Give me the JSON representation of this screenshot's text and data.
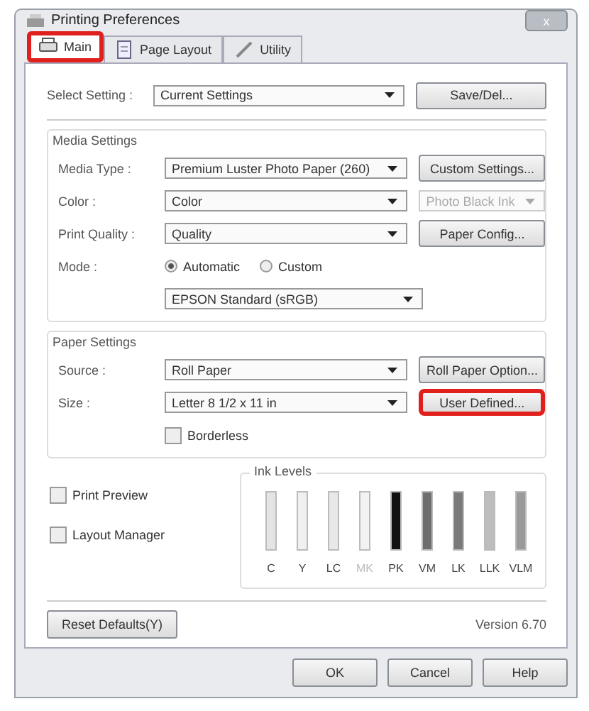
{
  "window": {
    "title": "Printing Preferences",
    "close": "x"
  },
  "tabs": [
    {
      "label": "Main",
      "selected": true,
      "highlighted": true
    },
    {
      "label": "Page Layout",
      "selected": false,
      "highlighted": false
    },
    {
      "label": "Utility",
      "selected": false,
      "highlighted": false
    }
  ],
  "select_setting": {
    "label": "Select Setting :",
    "value": "Current Settings",
    "button": {
      "label": "Save/Del...",
      "highlighted": false
    }
  },
  "media_settings": {
    "title": "Media Settings",
    "rows": [
      {
        "kind": "dropdown",
        "label": "Media Type :",
        "value": "Premium Luster Photo Paper (260)",
        "side": {
          "kind": "button",
          "label": "Custom Settings...",
          "highlighted": false
        }
      },
      {
        "kind": "dropdown",
        "label": "Color :",
        "value": "Color",
        "side": {
          "kind": "dropdown",
          "label": "Photo Black Ink",
          "disabled": true
        }
      },
      {
        "kind": "dropdown",
        "label": "Print Quality :",
        "value": "Quality",
        "side": {
          "kind": "button",
          "label": "Paper Config...",
          "highlighted": false
        }
      },
      {
        "kind": "radios",
        "label": "Mode :",
        "options": [
          {
            "label": "Automatic",
            "selected": true
          },
          {
            "label": "Custom",
            "selected": false
          }
        ]
      },
      {
        "kind": "dropdown",
        "value": "EPSON Standard (sRGB)"
      }
    ]
  },
  "paper_settings": {
    "title": "Paper Settings",
    "rows": [
      {
        "kind": "dropdown",
        "label": "Source :",
        "value": "Roll Paper",
        "side": {
          "kind": "button",
          "label": "Roll Paper Option...",
          "highlighted": false
        }
      },
      {
        "kind": "dropdown",
        "label": "Size :",
        "value": "Letter 8 1/2 x 11 in",
        "side": {
          "kind": "button",
          "label": "User Defined...",
          "highlighted": true
        }
      },
      {
        "kind": "checkbox",
        "label": "Borderless",
        "checked": false
      }
    ]
  },
  "options": [
    {
      "label": "Print Preview",
      "checked": false
    },
    {
      "label": "Layout Manager",
      "checked": false
    }
  ],
  "ink_levels": {
    "title": "Ink Levels",
    "inks": [
      {
        "name": "C",
        "color": "#e4e4e4",
        "disabled": false
      },
      {
        "name": "Y",
        "color": "#f0f0f0",
        "disabled": false
      },
      {
        "name": "LC",
        "color": "#e8e8e8",
        "disabled": false
      },
      {
        "name": "MK",
        "color": "#f2f2f2",
        "disabled": true
      },
      {
        "name": "PK",
        "color": "#111111",
        "disabled": false
      },
      {
        "name": "VM",
        "color": "#6e6e6e",
        "disabled": false
      },
      {
        "name": "LK",
        "color": "#7a7a7a",
        "disabled": false
      },
      {
        "name": "LLK",
        "color": "#bdbdbd",
        "disabled": false
      },
      {
        "name": "VLM",
        "color": "#9a9a9a",
        "disabled": false
      }
    ]
  },
  "reset_button": "Reset Defaults(Y)",
  "version": "Version 6.70",
  "buttons": [
    "OK",
    "Cancel",
    "Help"
  ]
}
